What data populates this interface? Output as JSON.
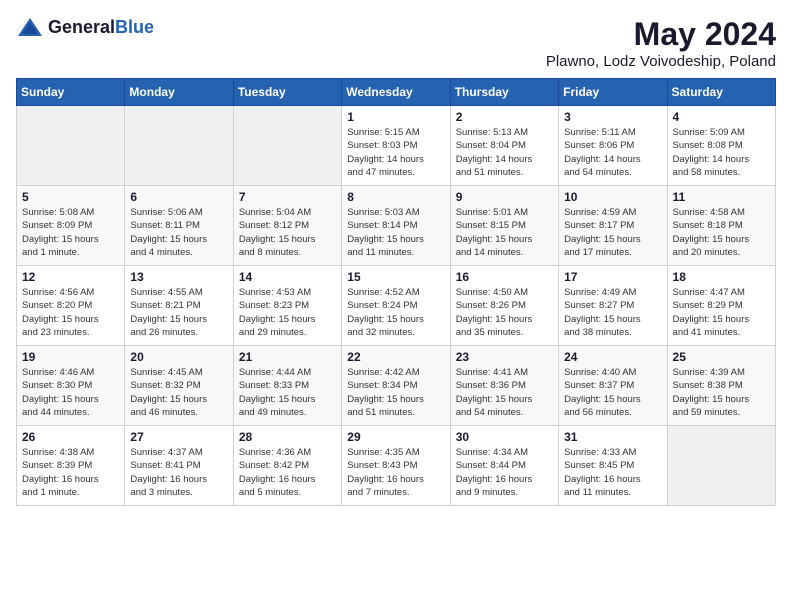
{
  "header": {
    "logo_general": "General",
    "logo_blue": "Blue",
    "month_title": "May 2024",
    "location": "Plawno, Lodz Voivodeship, Poland"
  },
  "days_of_week": [
    "Sunday",
    "Monday",
    "Tuesday",
    "Wednesday",
    "Thursday",
    "Friday",
    "Saturday"
  ],
  "weeks": [
    [
      {
        "day": "",
        "info": ""
      },
      {
        "day": "",
        "info": ""
      },
      {
        "day": "",
        "info": ""
      },
      {
        "day": "1",
        "info": "Sunrise: 5:15 AM\nSunset: 8:03 PM\nDaylight: 14 hours\nand 47 minutes."
      },
      {
        "day": "2",
        "info": "Sunrise: 5:13 AM\nSunset: 8:04 PM\nDaylight: 14 hours\nand 51 minutes."
      },
      {
        "day": "3",
        "info": "Sunrise: 5:11 AM\nSunset: 8:06 PM\nDaylight: 14 hours\nand 54 minutes."
      },
      {
        "day": "4",
        "info": "Sunrise: 5:09 AM\nSunset: 8:08 PM\nDaylight: 14 hours\nand 58 minutes."
      }
    ],
    [
      {
        "day": "5",
        "info": "Sunrise: 5:08 AM\nSunset: 8:09 PM\nDaylight: 15 hours\nand 1 minute."
      },
      {
        "day": "6",
        "info": "Sunrise: 5:06 AM\nSunset: 8:11 PM\nDaylight: 15 hours\nand 4 minutes."
      },
      {
        "day": "7",
        "info": "Sunrise: 5:04 AM\nSunset: 8:12 PM\nDaylight: 15 hours\nand 8 minutes."
      },
      {
        "day": "8",
        "info": "Sunrise: 5:03 AM\nSunset: 8:14 PM\nDaylight: 15 hours\nand 11 minutes."
      },
      {
        "day": "9",
        "info": "Sunrise: 5:01 AM\nSunset: 8:15 PM\nDaylight: 15 hours\nand 14 minutes."
      },
      {
        "day": "10",
        "info": "Sunrise: 4:59 AM\nSunset: 8:17 PM\nDaylight: 15 hours\nand 17 minutes."
      },
      {
        "day": "11",
        "info": "Sunrise: 4:58 AM\nSunset: 8:18 PM\nDaylight: 15 hours\nand 20 minutes."
      }
    ],
    [
      {
        "day": "12",
        "info": "Sunrise: 4:56 AM\nSunset: 8:20 PM\nDaylight: 15 hours\nand 23 minutes."
      },
      {
        "day": "13",
        "info": "Sunrise: 4:55 AM\nSunset: 8:21 PM\nDaylight: 15 hours\nand 26 minutes."
      },
      {
        "day": "14",
        "info": "Sunrise: 4:53 AM\nSunset: 8:23 PM\nDaylight: 15 hours\nand 29 minutes."
      },
      {
        "day": "15",
        "info": "Sunrise: 4:52 AM\nSunset: 8:24 PM\nDaylight: 15 hours\nand 32 minutes."
      },
      {
        "day": "16",
        "info": "Sunrise: 4:50 AM\nSunset: 8:26 PM\nDaylight: 15 hours\nand 35 minutes."
      },
      {
        "day": "17",
        "info": "Sunrise: 4:49 AM\nSunset: 8:27 PM\nDaylight: 15 hours\nand 38 minutes."
      },
      {
        "day": "18",
        "info": "Sunrise: 4:47 AM\nSunset: 8:29 PM\nDaylight: 15 hours\nand 41 minutes."
      }
    ],
    [
      {
        "day": "19",
        "info": "Sunrise: 4:46 AM\nSunset: 8:30 PM\nDaylight: 15 hours\nand 44 minutes."
      },
      {
        "day": "20",
        "info": "Sunrise: 4:45 AM\nSunset: 8:32 PM\nDaylight: 15 hours\nand 46 minutes."
      },
      {
        "day": "21",
        "info": "Sunrise: 4:44 AM\nSunset: 8:33 PM\nDaylight: 15 hours\nand 49 minutes."
      },
      {
        "day": "22",
        "info": "Sunrise: 4:42 AM\nSunset: 8:34 PM\nDaylight: 15 hours\nand 51 minutes."
      },
      {
        "day": "23",
        "info": "Sunrise: 4:41 AM\nSunset: 8:36 PM\nDaylight: 15 hours\nand 54 minutes."
      },
      {
        "day": "24",
        "info": "Sunrise: 4:40 AM\nSunset: 8:37 PM\nDaylight: 15 hours\nand 56 minutes."
      },
      {
        "day": "25",
        "info": "Sunrise: 4:39 AM\nSunset: 8:38 PM\nDaylight: 15 hours\nand 59 minutes."
      }
    ],
    [
      {
        "day": "26",
        "info": "Sunrise: 4:38 AM\nSunset: 8:39 PM\nDaylight: 16 hours\nand 1 minute."
      },
      {
        "day": "27",
        "info": "Sunrise: 4:37 AM\nSunset: 8:41 PM\nDaylight: 16 hours\nand 3 minutes."
      },
      {
        "day": "28",
        "info": "Sunrise: 4:36 AM\nSunset: 8:42 PM\nDaylight: 16 hours\nand 5 minutes."
      },
      {
        "day": "29",
        "info": "Sunrise: 4:35 AM\nSunset: 8:43 PM\nDaylight: 16 hours\nand 7 minutes."
      },
      {
        "day": "30",
        "info": "Sunrise: 4:34 AM\nSunset: 8:44 PM\nDaylight: 16 hours\nand 9 minutes."
      },
      {
        "day": "31",
        "info": "Sunrise: 4:33 AM\nSunset: 8:45 PM\nDaylight: 16 hours\nand 11 minutes."
      },
      {
        "day": "",
        "info": ""
      }
    ]
  ]
}
